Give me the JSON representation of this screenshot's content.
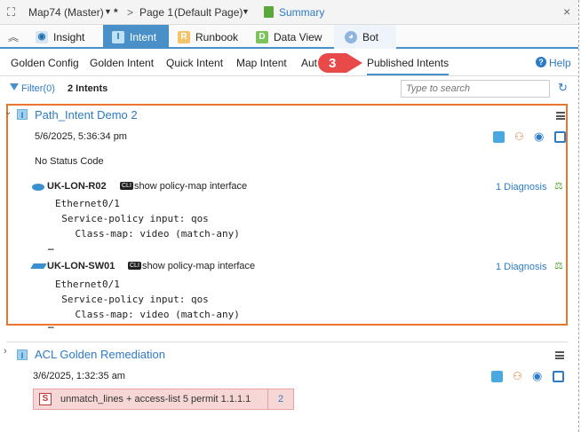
{
  "breadcrumb": {
    "map": "Map74 (Master)",
    "modified": "*",
    "separator": ">",
    "page": "Page 1",
    "page_suffix": "(Default Page)",
    "summary": "Summary"
  },
  "tabs": [
    {
      "label": "Insight"
    },
    {
      "label": "Intent"
    },
    {
      "label": "Runbook"
    },
    {
      "label": "Data View"
    },
    {
      "label": "Bot"
    }
  ],
  "subnav": {
    "items": [
      "Golden Config",
      "Golden Intent",
      "Quick Intent",
      "Map Intent",
      "Aut",
      "Published Intents"
    ],
    "help": "Help",
    "callout": "3"
  },
  "filter": {
    "label": "Filter(0)",
    "count": "2 Intents",
    "search_placeholder": "Type to search"
  },
  "intents": [
    {
      "title": "Path_Intent Demo 2",
      "timestamp": "5/6/2025, 5:36:34 pm",
      "status": "No Status Code",
      "devices": [
        {
          "name": "UK-LON-R02",
          "cli_badge": "CLI",
          "command": "show policy-map interface",
          "diagnosis": "1 Diagnosis",
          "output": [
            "Ethernet0/1",
            "  Service-policy input: qos",
            "    Class-map: video (match-any)",
            "…"
          ]
        },
        {
          "name": "UK-LON-SW01",
          "cli_badge": "CLI",
          "command": "show policy-map interface",
          "diagnosis": "1 Diagnosis",
          "output": [
            "Ethernet0/1",
            "  Service-policy input: qos",
            "    Class-map: video (match-any)",
            "…"
          ]
        }
      ]
    },
    {
      "title": "ACL Golden Remediation",
      "timestamp": "3/6/2025, 1:32:35 am",
      "badge": "S",
      "rule": "unmatch_lines + access-list 5 permit 1.1.1.1",
      "rule_count": "2"
    }
  ],
  "colors": {
    "accent": "#4a90c8",
    "highlight": "#e8762c",
    "link": "#2d7bc4",
    "callout": "#e84a4a"
  }
}
